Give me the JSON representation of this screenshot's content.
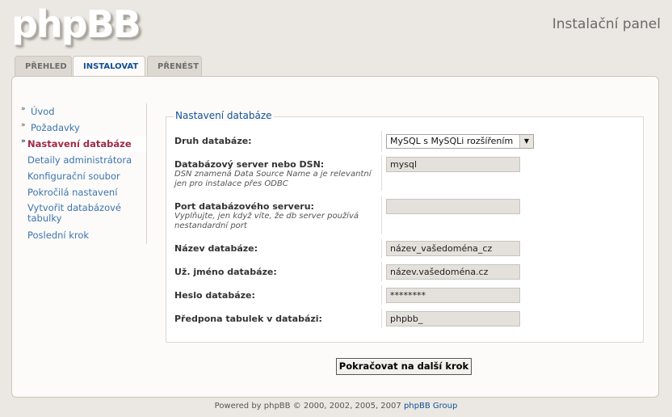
{
  "header": {
    "logo_text": "phpBB",
    "panel_title": "Instalační panel"
  },
  "tabs": [
    {
      "label": "PŘEHLED",
      "active": false
    },
    {
      "label": "INSTALOVAT",
      "active": true
    },
    {
      "label": "PŘENÉST",
      "active": false
    }
  ],
  "sidebar": {
    "items": [
      {
        "label": "Úvod",
        "state": "done"
      },
      {
        "label": "Požadavky",
        "state": "done"
      },
      {
        "label": "Nastavení databáze",
        "state": "active"
      },
      {
        "label": "Detaily administrátora",
        "state": "pending"
      },
      {
        "label": "Konfigurační soubor",
        "state": "pending"
      },
      {
        "label": "Pokročilá nastavení",
        "state": "pending"
      },
      {
        "label": "Vytvořit databázové tabulky",
        "state": "pending"
      },
      {
        "label": "Poslední krok",
        "state": "pending"
      }
    ]
  },
  "form": {
    "legend": "Nastavení databáze",
    "db_type": {
      "label": "Druh databáze:",
      "value": "MySQL s MySQLi rozšířením"
    },
    "db_host": {
      "label": "Databázový server nebo DSN:",
      "explain": "DSN znamená Data Source Name a je relevantní jen pro instalace přes ODBC",
      "value": "mysql"
    },
    "db_port": {
      "label": "Port databázového serveru:",
      "explain": "Vyplňujte, jen když víte, že db server používá nestandardní port",
      "value": ""
    },
    "db_name": {
      "label": "Název databáze:",
      "value": "název_vašedoména_cz"
    },
    "db_user": {
      "label": "Už. jméno databáze:",
      "value": "název.vašedoména.cz"
    },
    "db_pass": {
      "label": "Heslo databáze:",
      "value": "********"
    },
    "table_prefix": {
      "label": "Předpona tabulek v databázi:",
      "value": "phpbb_"
    },
    "submit_label": "Pokračovat na další krok"
  },
  "footer": {
    "text": "Powered by phpBB © 2000, 2002, 2005, 2007",
    "link": "phpBB Group"
  }
}
